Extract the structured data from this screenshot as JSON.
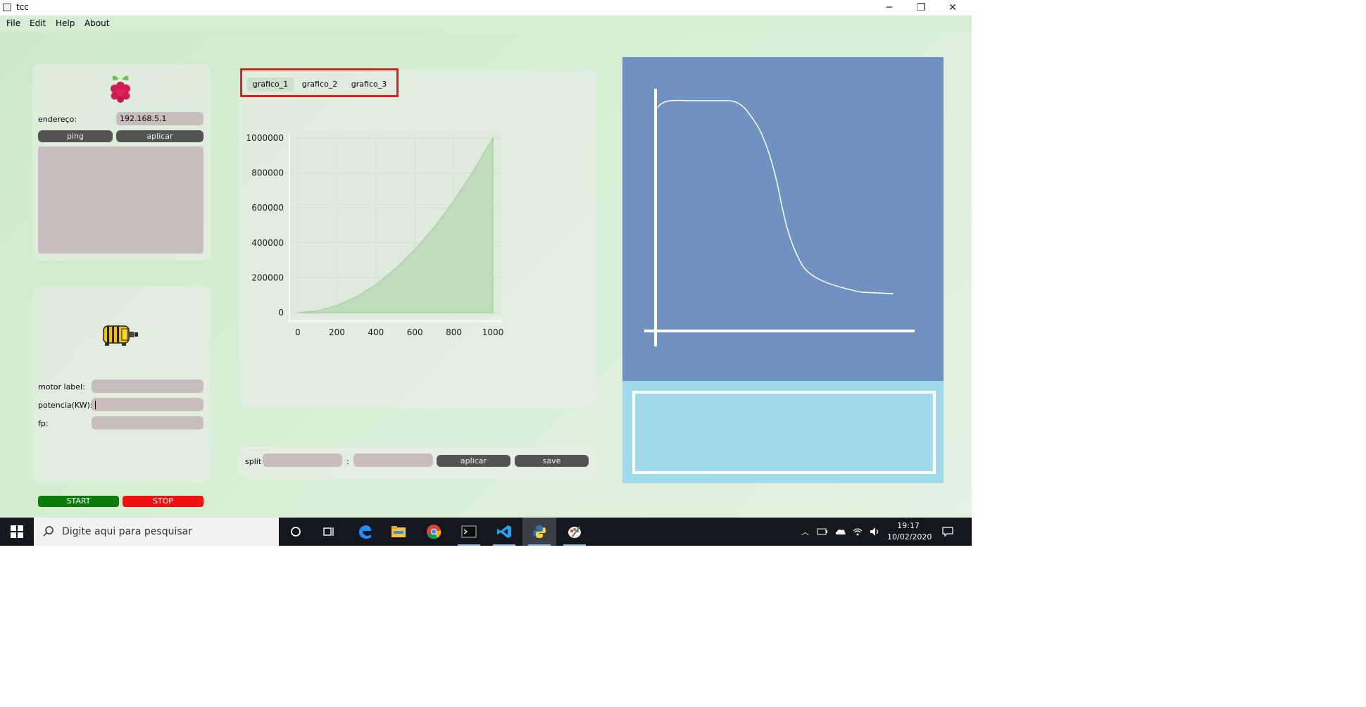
{
  "window": {
    "title": "tcc",
    "minimize_glyph": "─",
    "maximize_glyph": "❐",
    "close_glyph": "✕"
  },
  "menu": [
    "File",
    "Edit",
    "Help",
    "About"
  ],
  "rpi_panel": {
    "icon": "raspberry-pi-icon",
    "address_label": "endereço:",
    "address_value": "192.168.5.1",
    "ping_label": "ping",
    "apply_label": "aplicar"
  },
  "motor_panel": {
    "icon": "motor-icon",
    "motor_label_label": "motor label:",
    "motor_label_value": "",
    "power_label": "potencia(KW):",
    "power_value": "",
    "fp_label": "fp:",
    "fp_value": "",
    "start_label": "START",
    "stop_label": "STOP"
  },
  "tabs": [
    {
      "label": "grafico_1",
      "active": true
    },
    {
      "label": "grafico_2",
      "active": false
    },
    {
      "label": "grafico_3",
      "active": false
    }
  ],
  "split_panel": {
    "split_label": "split",
    "separator": ":",
    "value_from": "",
    "value_to": "",
    "apply_label": "aplicar",
    "save_label": "save"
  },
  "chart_data": {
    "type": "area",
    "x": [
      0,
      100,
      200,
      300,
      400,
      500,
      600,
      700,
      800,
      900,
      1000
    ],
    "series": [
      {
        "values": [
          0,
          10000,
          40000,
          90000,
          160000,
          250000,
          360000,
          490000,
          640000,
          810000,
          1000000
        ]
      }
    ],
    "xticks": [
      "0",
      "200",
      "400",
      "600",
      "800",
      "1000"
    ],
    "yticks": [
      "0",
      "200000",
      "400000",
      "600000",
      "800000",
      "1000000"
    ],
    "xlim": [
      0,
      1000
    ],
    "ylim": [
      0,
      1000000
    ],
    "grid": true,
    "fill_color": "#b5d8b0",
    "line_color": "#a9d2a3"
  },
  "taskbar": {
    "search_placeholder": "Digite aqui para pesquisar",
    "time": "19:17",
    "date": "10/02/2020",
    "apps": [
      "cortana-icon",
      "task-view-icon",
      "edge-icon",
      "file-explorer-icon",
      "chrome-icon",
      "terminal-icon",
      "vscode-icon",
      "python-icon",
      "paint-icon"
    ]
  },
  "colors": {
    "accent_red": "#e01b24",
    "start_green": "#0b7c0b",
    "stop_red": "#f01111",
    "plot_bg": "#6f92c0",
    "plot_bottom_bg": "#9edae9"
  }
}
